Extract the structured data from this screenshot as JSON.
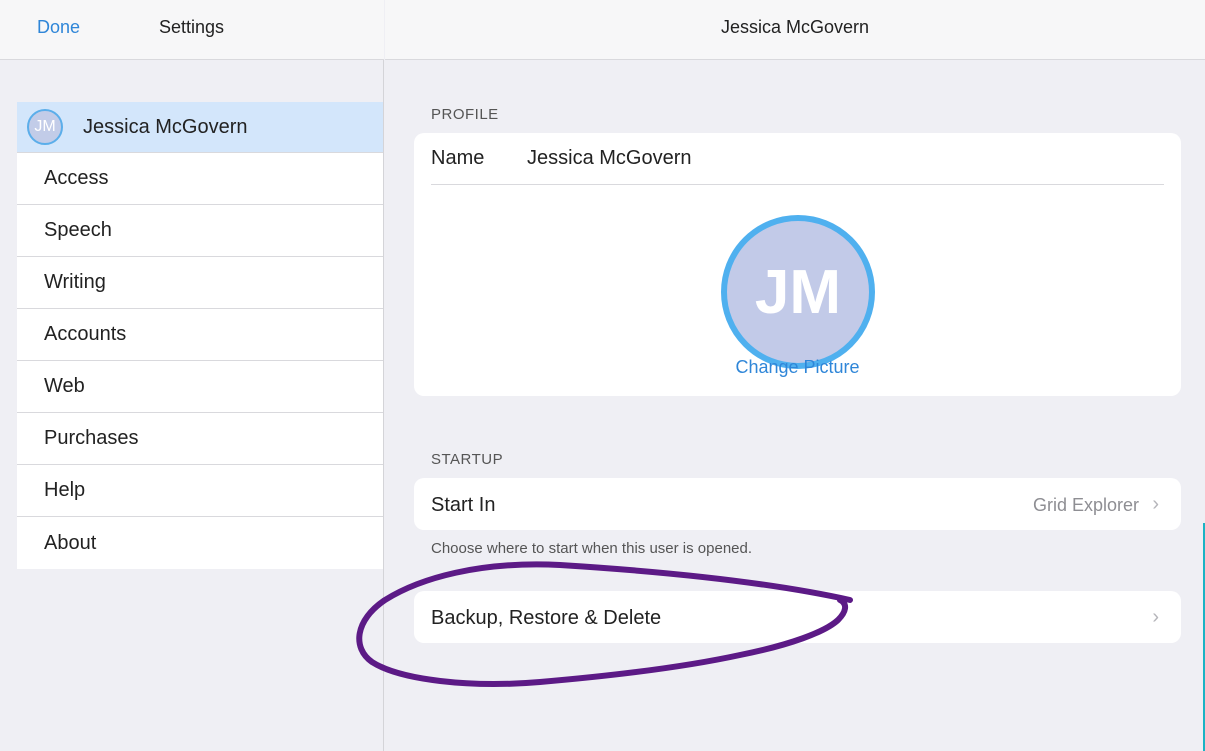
{
  "left_nav": {
    "done_label": "Done",
    "title": "Settings"
  },
  "menu": {
    "user": {
      "initials": "JM",
      "label": "Jessica McGovern"
    },
    "items": [
      {
        "label": "Access"
      },
      {
        "label": "Speech"
      },
      {
        "label": "Writing"
      },
      {
        "label": "Accounts"
      },
      {
        "label": "Web"
      },
      {
        "label": "Purchases"
      },
      {
        "label": "Help"
      },
      {
        "label": "About"
      }
    ]
  },
  "right_nav": {
    "title": "Jessica McGovern"
  },
  "profile": {
    "header": "PROFILE",
    "name_label": "Name",
    "name_value": "Jessica McGovern",
    "avatar_initials": "JM",
    "change_picture_label": "Change Picture"
  },
  "startup": {
    "header": "STARTUP",
    "start_in_label": "Start In",
    "start_in_value": "Grid Explorer",
    "footer": "Choose where to start when this user is opened."
  },
  "backup": {
    "label": "Backup, Restore & Delete"
  },
  "colors": {
    "accent": "#2f86d8",
    "selected_row": "#d3e6fb",
    "avatar_ring": "#4fb0ef",
    "annotation": "#5c1a86"
  },
  "icons": {
    "chevron": "chevron-right-icon"
  }
}
